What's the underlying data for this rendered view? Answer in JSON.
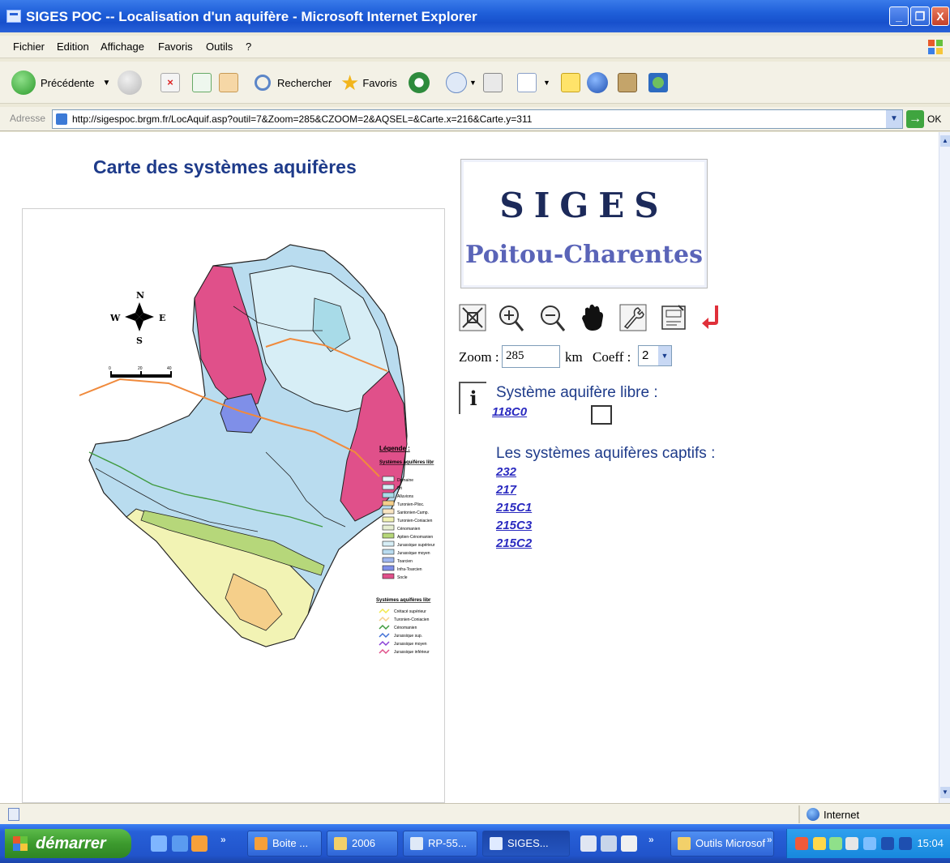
{
  "window": {
    "title": "SIGES POC -- Localisation d'un aquifère - Microsoft Internet Explorer",
    "minimize_glyph": "_",
    "maximize_glyph": "❐",
    "close_glyph": "X"
  },
  "menu": [
    "Fichier",
    "Edition",
    "Affichage",
    "Favoris",
    "Outils",
    "?"
  ],
  "toolbar": {
    "back_label": "Précédente",
    "search_label": "Rechercher",
    "favorites_label": "Favoris"
  },
  "address": {
    "label": "Adresse",
    "url": "http://sigespoc.brgm.fr/LocAquif.asp?outil=7&Zoom=285&CZOOM=2&AQSEL=&Carte.x=216&Carte.y=311",
    "go_label": "OK"
  },
  "page": {
    "map_title": "Carte des systèmes aquifères",
    "logo_line1": "SIGES",
    "logo_line2": "Poitou-Charentes",
    "zoom_label": "Zoom :",
    "zoom_value": "285",
    "km_label": "km",
    "coeff_label": "Coeff :",
    "coeff_value": "2",
    "info_glyph": "i",
    "libre_title": "Système aquifère libre :",
    "libre_link": "118C0",
    "captifs_title": "Les systèmes aquifères captifs :",
    "captifs_links": [
      "232",
      "217",
      "215C1",
      "215C3",
      "215C2"
    ]
  },
  "map": {
    "compass": {
      "n": "N",
      "s": "S",
      "e": "E",
      "w": "W"
    },
    "scale_labels": [
      "0",
      "20",
      "40"
    ],
    "legend_title": "Légende :",
    "legend_subtitle_1": "Systèmes aquifères libr",
    "legend_items": [
      "Domaine",
      "Bri",
      "Alluvions",
      "Turonien-Plioc.",
      "Santonien-Camp.",
      "Turonien-Coniacien",
      "Cénomanien",
      "Aptien-Cénomanien",
      "Jurassique supérieur",
      "Jurassique moyen",
      "Toarcien",
      "Infra-Toarcien",
      "Socle"
    ],
    "legend_subtitle_2": "Systèmes aquifères libr",
    "legend_items_2": [
      "Crétacé supérieur",
      "Turonien-Coniacien",
      "Cénomanien",
      "Jurassique sup.",
      "Jurassique moyen",
      "Jurassique inférieur"
    ],
    "colors": {
      "socle": "#e0508a",
      "jurassique_moyen": "#b9dcef",
      "jurassique_sup": "#d7eef6",
      "cretace": "#f2f3b4",
      "turonien": "#f5cf8a",
      "cenomanien": "#b6d77a",
      "toarcien": "#7f8fe8",
      "alluvions": "#a8dbe8",
      "river_orange": "#f08a3c"
    }
  },
  "status": {
    "zone": "Internet"
  },
  "taskbar": {
    "start_label": "démarrer",
    "tasks": [
      "Boite ...",
      "2006",
      "RP-55...",
      "SIGES...",
      "Outils Microsof"
    ],
    "clock": "15:04"
  }
}
